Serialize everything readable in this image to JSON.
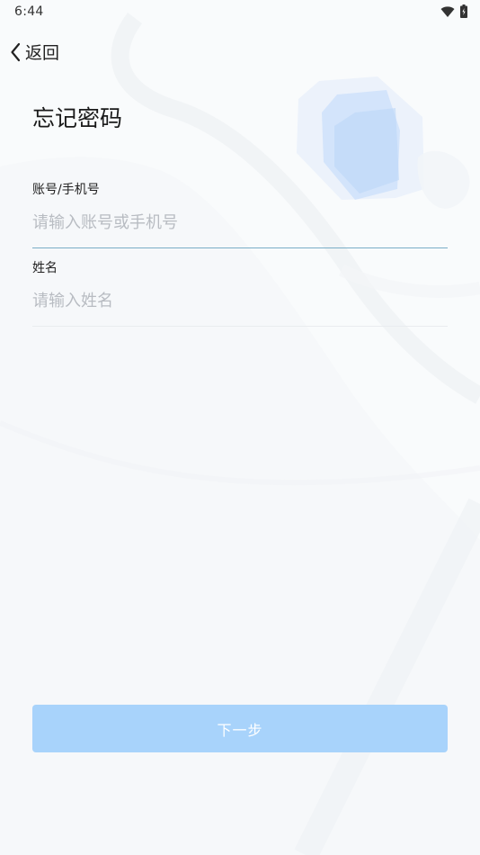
{
  "status_bar": {
    "time": "6:44",
    "icons": [
      "wifi-icon",
      "battery-icon"
    ]
  },
  "header": {
    "back_label": "返回",
    "back_icon": "chevron-left-icon"
  },
  "page": {
    "title": "忘记密码"
  },
  "form": {
    "account": {
      "label": "账号/手机号",
      "value": "",
      "placeholder": "请输入账号或手机号"
    },
    "name": {
      "label": "姓名",
      "value": "",
      "placeholder": "请输入姓名"
    }
  },
  "actions": {
    "next_label": "下一步"
  },
  "colors": {
    "primary_button_disabled": "#a8d3fb",
    "focused_underline": "#7aaec7",
    "placeholder": "#b8bcc2",
    "background": "#f9fbfc"
  }
}
